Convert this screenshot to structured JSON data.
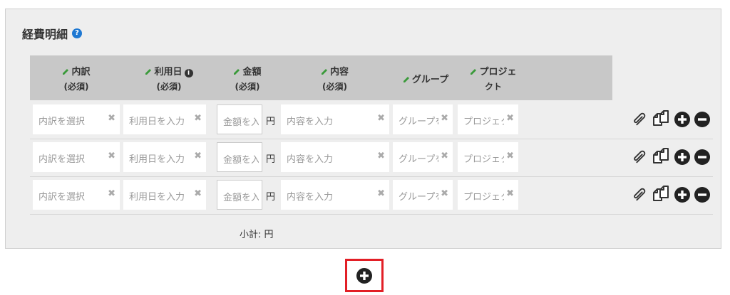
{
  "section": {
    "title": "経費明細",
    "help_icon": "question-circle-icon",
    "help_glyph": "?"
  },
  "columns": [
    {
      "label": "内訳",
      "sub": "(必須)"
    },
    {
      "label": "利用日",
      "sub": "(必須)",
      "info_glyph": "i"
    },
    {
      "label": "金額",
      "sub": "(必須)"
    },
    {
      "label": "内容",
      "sub": "(必須)"
    },
    {
      "label": "グループ",
      "sub": ""
    },
    {
      "label": "プロジェ",
      "sub": "クト"
    }
  ],
  "rows": [
    {
      "breakdown_ph": "内訳を選択",
      "date_ph": "利用日を入力",
      "amount_ph": "金額を入力",
      "currency": "円",
      "content_ph": "内容を入力",
      "group_ph": "グループを選択",
      "project_ph": "プロジェクトを選択"
    },
    {
      "breakdown_ph": "内訳を選択",
      "date_ph": "利用日を入力",
      "amount_ph": "金額を入力",
      "currency": "円",
      "content_ph": "内容を入力",
      "group_ph": "グループを選択",
      "project_ph": "プロジェクトを選択"
    },
    {
      "breakdown_ph": "内訳を選択",
      "date_ph": "利用日を入力",
      "amount_ph": "金額を入力",
      "currency": "円",
      "content_ph": "内容を入力",
      "group_ph": "グループを選択",
      "project_ph": "プロジェクトを選択"
    }
  ],
  "clear_glyph": "✖",
  "row_actions": [
    "paperclip-icon",
    "copy-icon",
    "plus-circle-icon",
    "minus-circle-icon"
  ],
  "subtotal": "小計: 円",
  "add_button": {
    "icon": "plus-circle-icon"
  },
  "colors": {
    "panel_bg": "#eeeeee",
    "header_bg": "#c8c8c8",
    "pencil": "#3a9a3a",
    "help": "#1e78d2",
    "highlight": "#e21f26"
  }
}
